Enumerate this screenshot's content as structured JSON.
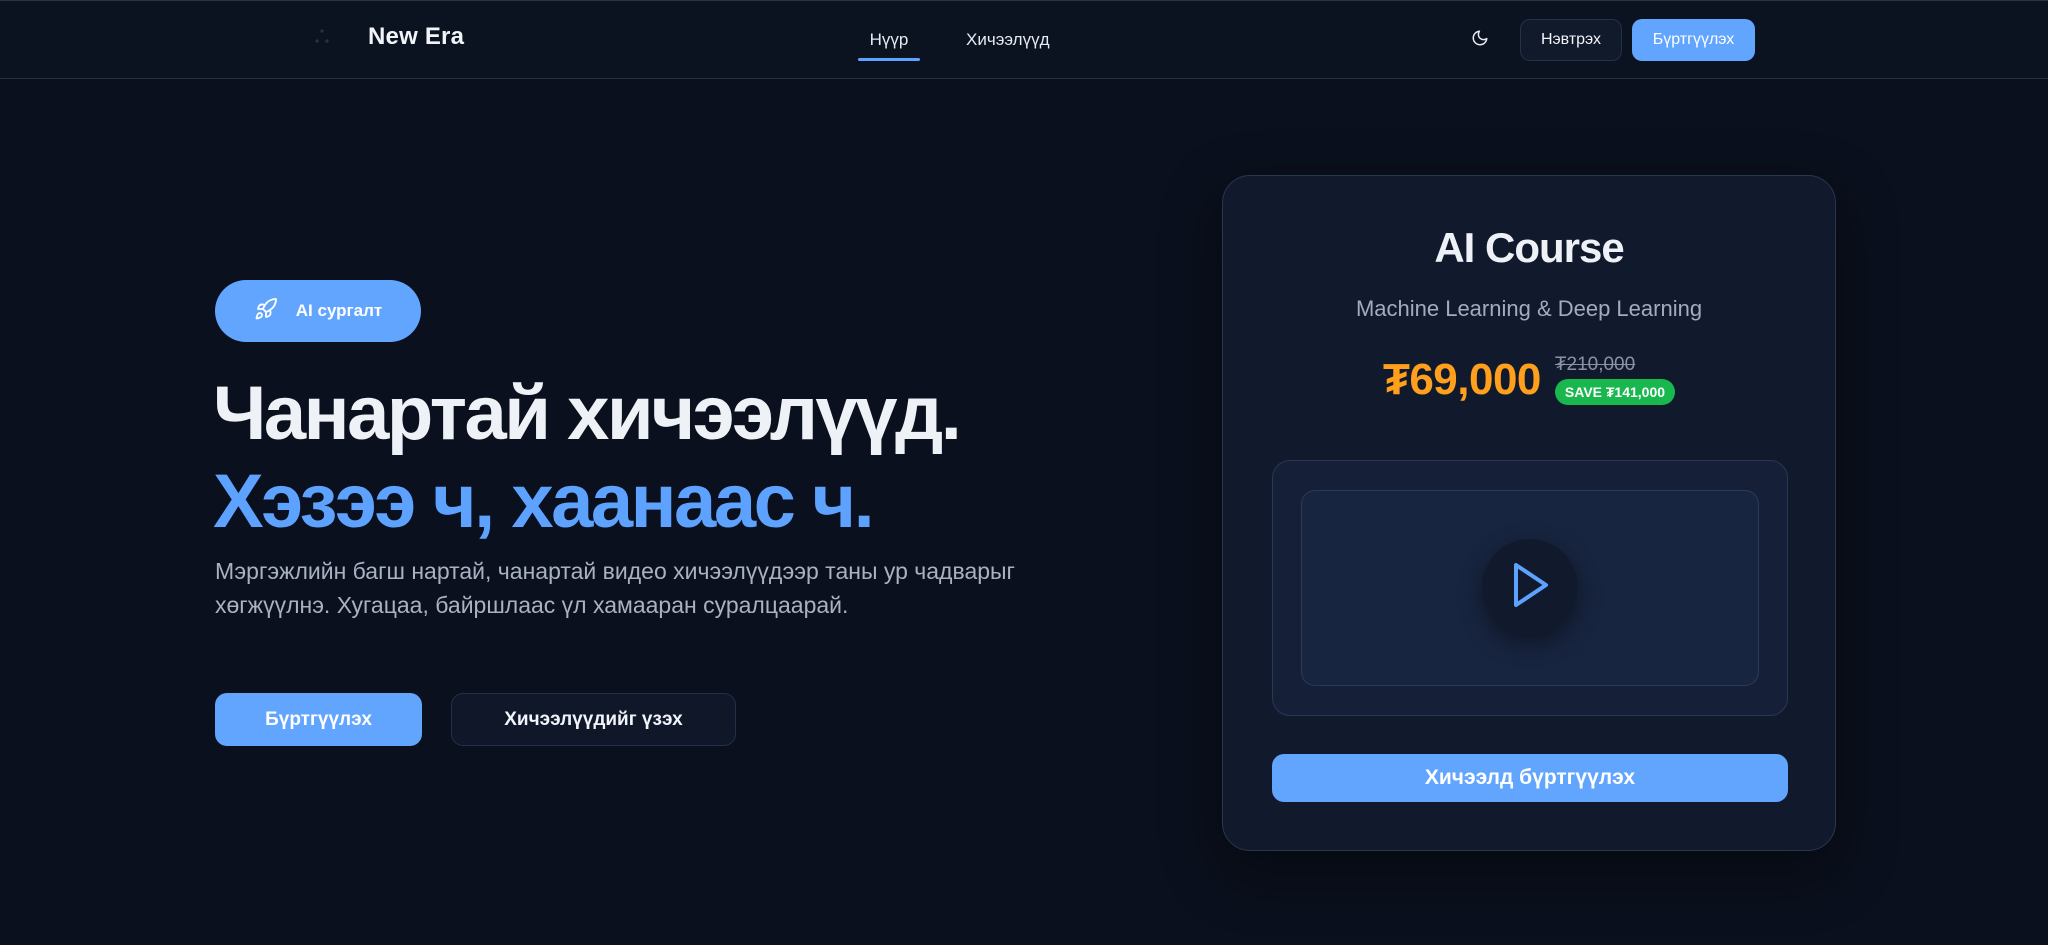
{
  "header": {
    "brand_name": "New Era",
    "brand_icon": "logo-icon",
    "nav": [
      {
        "label": "Нүүр",
        "active": true
      },
      {
        "label": "Хичээлүүд",
        "active": false
      }
    ],
    "theme_toggle_icon": "moon-icon",
    "login_label": "Нэвтрэх",
    "register_label": "Бүртгүүлэх"
  },
  "hero": {
    "badge_icon": "rocket-icon",
    "badge_label": "AI сургалт",
    "headline_line1": "Чанартай хичээлүүд.",
    "headline_line2": "Хэзээ ч, хаанаас ч.",
    "lead": "Мэргэжлийн багш нартай, чанартай видео хичээлүүдээр таны ур чадварыг хөгжүүлнэ. Хугацаа, байршлаас үл хамааран суралцаарай.",
    "primary_button": "Бүртгүүлэх",
    "secondary_button": "Хичээлүүдийг үзэх"
  },
  "course_card": {
    "title": "AI Course",
    "subtitle": "Machine Learning & Deep Learning",
    "price": "₮69,000",
    "old_price": "₮210,000",
    "save_badge": "SAVE ₮141,000",
    "video_icon": "play-icon",
    "enroll_button": "Хичээлд бүртгүүлэх"
  },
  "colors": {
    "background": "#0a101d",
    "accent": "#62a5ff",
    "price": "#ff9f1c",
    "save": "#18b84f"
  }
}
